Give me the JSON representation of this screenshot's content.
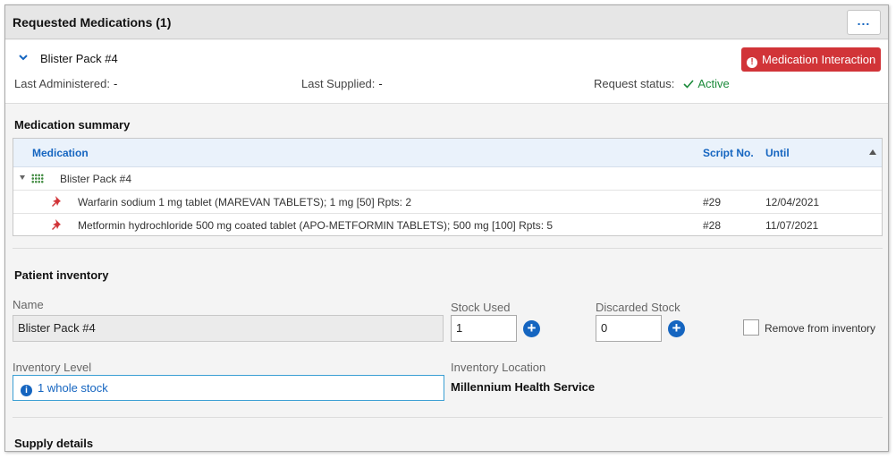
{
  "window": {
    "title": "Requested Medications (1)",
    "more_label": "..."
  },
  "header": {
    "pack_title": "Blister Pack #4",
    "interaction_button": "Medication Interaction",
    "last_administered_label": "Last Administered:",
    "last_administered_value": "-",
    "last_supplied_label": "Last Supplied:",
    "last_supplied_value": "-",
    "request_status_label": "Request status:",
    "request_status_value": "Active",
    "status_color": "#1b8a3a",
    "alert_color": "#d13438"
  },
  "medication_summary": {
    "title": "Medication summary",
    "columns": [
      "Medication",
      "Script No.",
      "Until"
    ],
    "group": {
      "label": "Blister Pack #4",
      "icon": "grid-icon"
    },
    "rows": [
      {
        "icon": "pin-icon",
        "medication": "Warfarin sodium 1 mg tablet (MAREVAN TABLETS); 1 mg [50] Rpts: 2",
        "script_no": "#29",
        "until": "12/04/2021"
      },
      {
        "icon": "pin-icon",
        "medication": "Metformin hydrochloride 500 mg coated tablet (APO-METFORMIN TABLETS); 500 mg [100] Rpts: 5",
        "script_no": "#28",
        "until": "11/07/2021"
      }
    ]
  },
  "patient_inventory": {
    "title": "Patient inventory",
    "name_label": "Name",
    "name_value": "Blister Pack #4",
    "stock_used_label": "Stock Used",
    "stock_used_value": "1",
    "discarded_label": "Discarded Stock",
    "discarded_value": "0",
    "remove_label": "Remove from inventory",
    "level_label": "Inventory Level",
    "level_value": "1 whole stock",
    "location_label": "Inventory Location",
    "location_value": "Millennium Health Service"
  },
  "supply_details": {
    "title": "Supply details"
  },
  "accent_color": "#1565c0"
}
